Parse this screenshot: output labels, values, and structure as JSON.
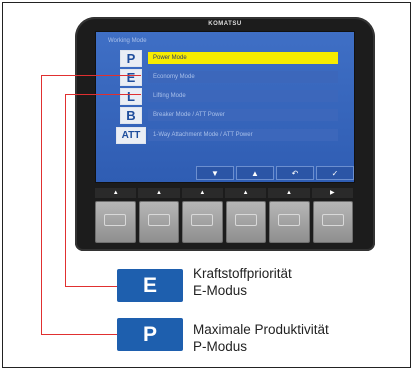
{
  "monitor": {
    "brand": "KOMATSU",
    "screen_title": "Working Mode",
    "modes": [
      {
        "key": "P",
        "label": "Power Mode",
        "active": true
      },
      {
        "key": "E",
        "label": "Economy Mode",
        "active": false
      },
      {
        "key": "L",
        "label": "Lifting Mode",
        "active": false
      },
      {
        "key": "B",
        "label": "Breaker Mode / ATT Power",
        "active": false
      },
      {
        "key": "ATT",
        "label": "1-Way Attachment Mode / ATT Power",
        "active": false
      }
    ],
    "nav_buttons": [
      "▼",
      "▲",
      "↶",
      "✓"
    ],
    "indicators": [
      "▲",
      "▲",
      "▲",
      "▲",
      "▲",
      "▶"
    ],
    "softkeys": [
      "1",
      "2",
      "3",
      "4",
      "5",
      "6"
    ]
  },
  "legend": [
    {
      "key": "E",
      "line1": "Kraftstoffpriorität",
      "line2": "E-Modus"
    },
    {
      "key": "P",
      "line1": "Maximale Produktivität",
      "line2": "P-Modus"
    }
  ],
  "colors": {
    "callout_line": "#e03030",
    "key_blue": "#1e5fae",
    "screen_blue": "#2f5db3",
    "active_highlight": "#f6ec00"
  }
}
